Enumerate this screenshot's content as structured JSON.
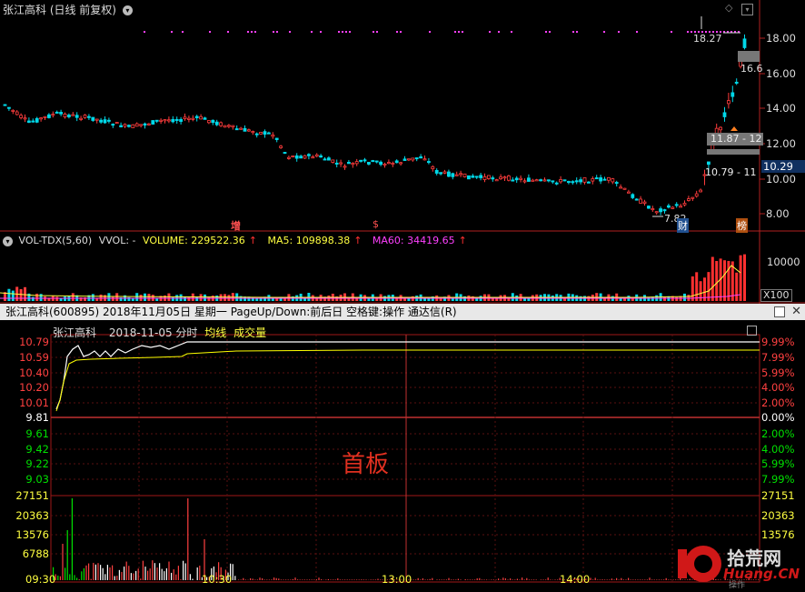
{
  "kline": {
    "title": "张江高科 (日线 前复权)",
    "dropdown_icon": "chevron-down-icon",
    "right_axis": [
      "18.00",
      "16.00",
      "14.00",
      "12.00",
      "10.00",
      "8.00"
    ],
    "current_price_label": "10.29",
    "high_label": "18.27",
    "low_label": "7.82",
    "partial_label": "16.6",
    "range_box_1": "11.87 - 12",
    "range_box_2": "10.79 - 11",
    "markers": {
      "zeng": "增",
      "s": "$",
      "cai": "财",
      "bang": "榜"
    },
    "colors": {
      "up": "#ff3c3c",
      "down": "#00d8e8",
      "magenta": "#ff40ff"
    }
  },
  "volume": {
    "name": "VOL-TDX(5,60)",
    "vvol": "VVOL: -",
    "volume_label": "VOLUME: 229522.36",
    "ma5_label": "MA5: 109898.38",
    "ma60_label": "MA60: 34419.65",
    "arrow": "↑",
    "axis_top": "10000",
    "axis_unit": "X100"
  },
  "intraday_panel": {
    "bar_title": "张江高科(600895)  2018年11月05日 星期一  PageUp/Down:前后日 空格键:操作  通达信(R)",
    "header_name": "张江高科",
    "header_date": "2018-11-05 分时",
    "avg_label": "均线",
    "vol_label": "成交量",
    "watermark": "首板",
    "left_prices": [
      "10.79",
      "10.59",
      "10.40",
      "10.20",
      "10.01",
      "9.81",
      "9.61",
      "9.42",
      "9.22",
      "9.03"
    ],
    "right_pcts": [
      "9.99%",
      "7.99%",
      "5.99%",
      "4.00%",
      "2.00%",
      "0.00%",
      "2.00%",
      "4.00%",
      "5.99%",
      "7.99%"
    ],
    "vol_left": [
      "27151",
      "20363",
      "13576",
      "6788"
    ],
    "vol_right": [
      "27151",
      "20363",
      "13576"
    ],
    "times": [
      "09:30",
      "10:30",
      "13:00",
      "14:00"
    ],
    "colors": {
      "up_price": "#ff4040",
      "down_price": "#00e000",
      "price_line": "#ffffff",
      "avg_line": "#ffff00"
    }
  },
  "logo": {
    "number": "10",
    "cn": "拾荒网",
    "en": "Huang.CN",
    "sub": "操作"
  }
}
